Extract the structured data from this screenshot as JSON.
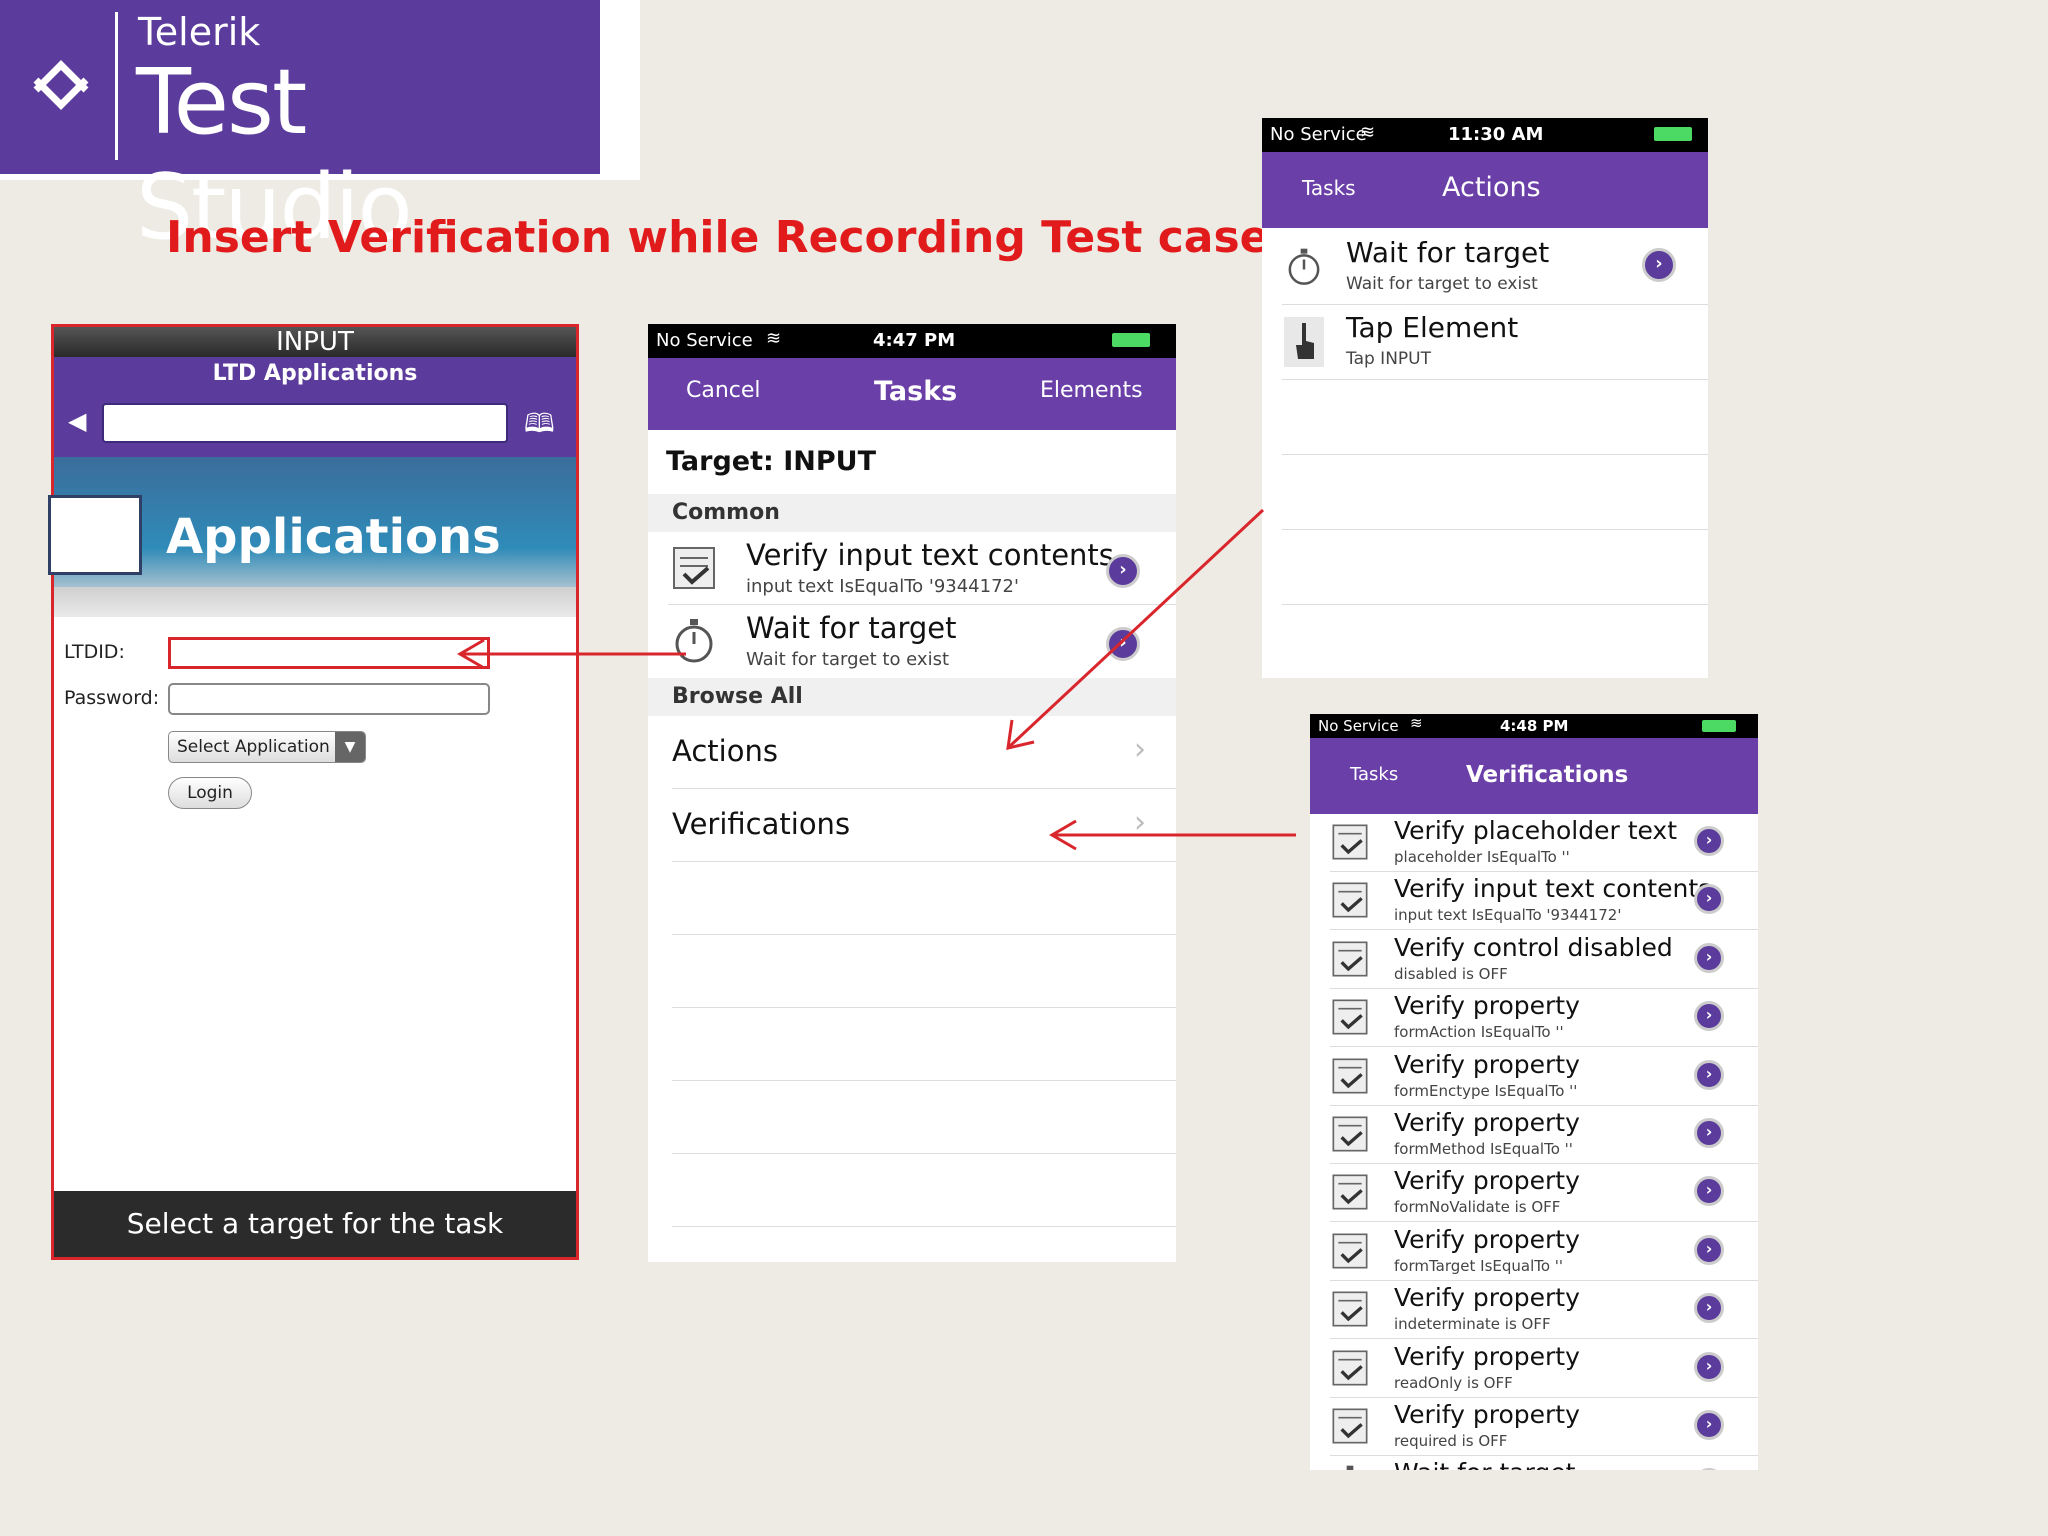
{
  "logo": {
    "small": "Telerik",
    "big": "Test Studio"
  },
  "headline": "Insert Verification while Recording Test case",
  "phone1": {
    "top_title": "INPUT",
    "nav_title": "LTD Applications",
    "banner_title": "Applications",
    "ltdid_label": "LTDID:",
    "password_label": "Password:",
    "select_label": "Select Application",
    "login_label": "Login",
    "bottom_text": "Select a target for the task"
  },
  "phone2": {
    "status": {
      "carrier": "No Service",
      "time": "4:47 PM"
    },
    "nav": {
      "cancel": "Cancel",
      "title": "Tasks",
      "elements": "Elements"
    },
    "target": "Target: INPUT",
    "common_header": "Common",
    "common_items": [
      {
        "title": "Verify input text contents",
        "sub": "input text IsEqualTo '9344172'"
      },
      {
        "title": "Wait for target",
        "sub": "Wait for target to exist"
      }
    ],
    "browse_header": "Browse All",
    "browse_items": [
      "Actions",
      "Verifications"
    ]
  },
  "phone3": {
    "status": {
      "carrier": "No Service",
      "time": "11:30 AM"
    },
    "nav": {
      "back": "Tasks",
      "title": "Actions"
    },
    "items": [
      {
        "title": "Wait for target",
        "sub": "Wait for target to exist"
      },
      {
        "title": "Tap Element",
        "sub": "Tap INPUT"
      }
    ]
  },
  "phone4": {
    "status": {
      "carrier": "No Service",
      "time": "4:48 PM"
    },
    "nav": {
      "back": "Tasks",
      "title": "Verifications"
    },
    "items": [
      {
        "title": "Verify placeholder text",
        "sub": "placeholder IsEqualTo ''"
      },
      {
        "title": "Verify input text contents",
        "sub": "input text IsEqualTo '9344172'"
      },
      {
        "title": "Verify control disabled",
        "sub": "disabled is OFF"
      },
      {
        "title": "Verify property",
        "sub": "formAction IsEqualTo ''"
      },
      {
        "title": "Verify property",
        "sub": "formEnctype IsEqualTo ''"
      },
      {
        "title": "Verify property",
        "sub": "formMethod IsEqualTo ''"
      },
      {
        "title": "Verify property",
        "sub": "formNoValidate is OFF"
      },
      {
        "title": "Verify property",
        "sub": "formTarget IsEqualTo ''"
      },
      {
        "title": "Verify property",
        "sub": "indeterminate is OFF"
      },
      {
        "title": "Verify property",
        "sub": "readOnly is OFF"
      },
      {
        "title": "Verify property",
        "sub": "required is OFF"
      },
      {
        "title": "Wait for target",
        "sub": ""
      }
    ]
  },
  "colors": {
    "purple": "#6a3fa8",
    "logo_purple": "#5b3b9b",
    "red": "#e11b1b",
    "background": "#eeebe4"
  }
}
